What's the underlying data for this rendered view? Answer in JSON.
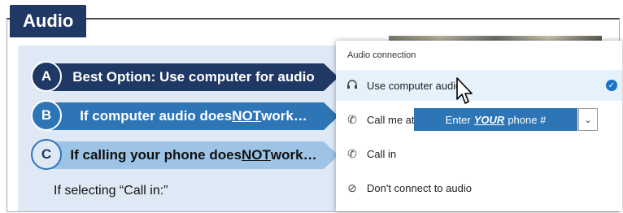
{
  "title": "Audio",
  "banners": {
    "a": {
      "letter": "A",
      "text": "Best Option: Use computer for audio"
    },
    "b": {
      "letter": "B",
      "text_before": "If computer audio does ",
      "text_em": "NOT",
      "text_after": " work…"
    },
    "c": {
      "letter": "C",
      "text_before": "If calling your phone does ",
      "text_em": "NOT",
      "text_after": " work…"
    }
  },
  "selecting_note": "If selecting “Call in:”",
  "panel": {
    "heading": "Audio connection",
    "options": {
      "computer": "Use computer audio",
      "callme": "Call me at",
      "callin": "Call in",
      "dont": "Don't connect to audio"
    },
    "phone_before": "Enter ",
    "phone_em": "YOUR",
    "phone_after": " phone #",
    "dropdown_icon": "chevron-down-icon",
    "selected_icon": "check-circle-icon"
  }
}
